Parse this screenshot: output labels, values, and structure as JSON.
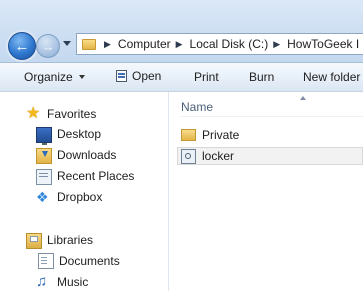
{
  "address_bar": {
    "crumbs": [
      "Computer",
      "Local Disk (C:)",
      "HowToGeek I"
    ],
    "separator": "▶"
  },
  "navigation": {
    "back_icon": "back-arrow-icon",
    "forward_icon": "forward-arrow-icon"
  },
  "toolbar": {
    "organize": "Organize",
    "open": "Open",
    "print": "Print",
    "burn": "Burn",
    "new_folder": "New folder"
  },
  "sidebar": {
    "favorites": {
      "label": "Favorites",
      "items": [
        {
          "label": "Desktop",
          "icon": "desktop-icon"
        },
        {
          "label": "Downloads",
          "icon": "downloads-icon"
        },
        {
          "label": "Recent Places",
          "icon": "recent-places-icon"
        },
        {
          "label": "Dropbox",
          "icon": "dropbox-icon"
        }
      ]
    },
    "libraries": {
      "label": "Libraries",
      "items": [
        {
          "label": "Documents",
          "icon": "documents-icon"
        },
        {
          "label": "Music",
          "icon": "music-icon"
        }
      ]
    }
  },
  "content": {
    "column_name": "Name",
    "files": [
      {
        "name": "Private",
        "type": "folder"
      },
      {
        "name": "locker",
        "type": "file",
        "selected": true
      }
    ]
  },
  "colors": {
    "chrome_top": "#dce9f7",
    "toolbar": "#e8f0f9",
    "header_text": "#4c607a"
  }
}
